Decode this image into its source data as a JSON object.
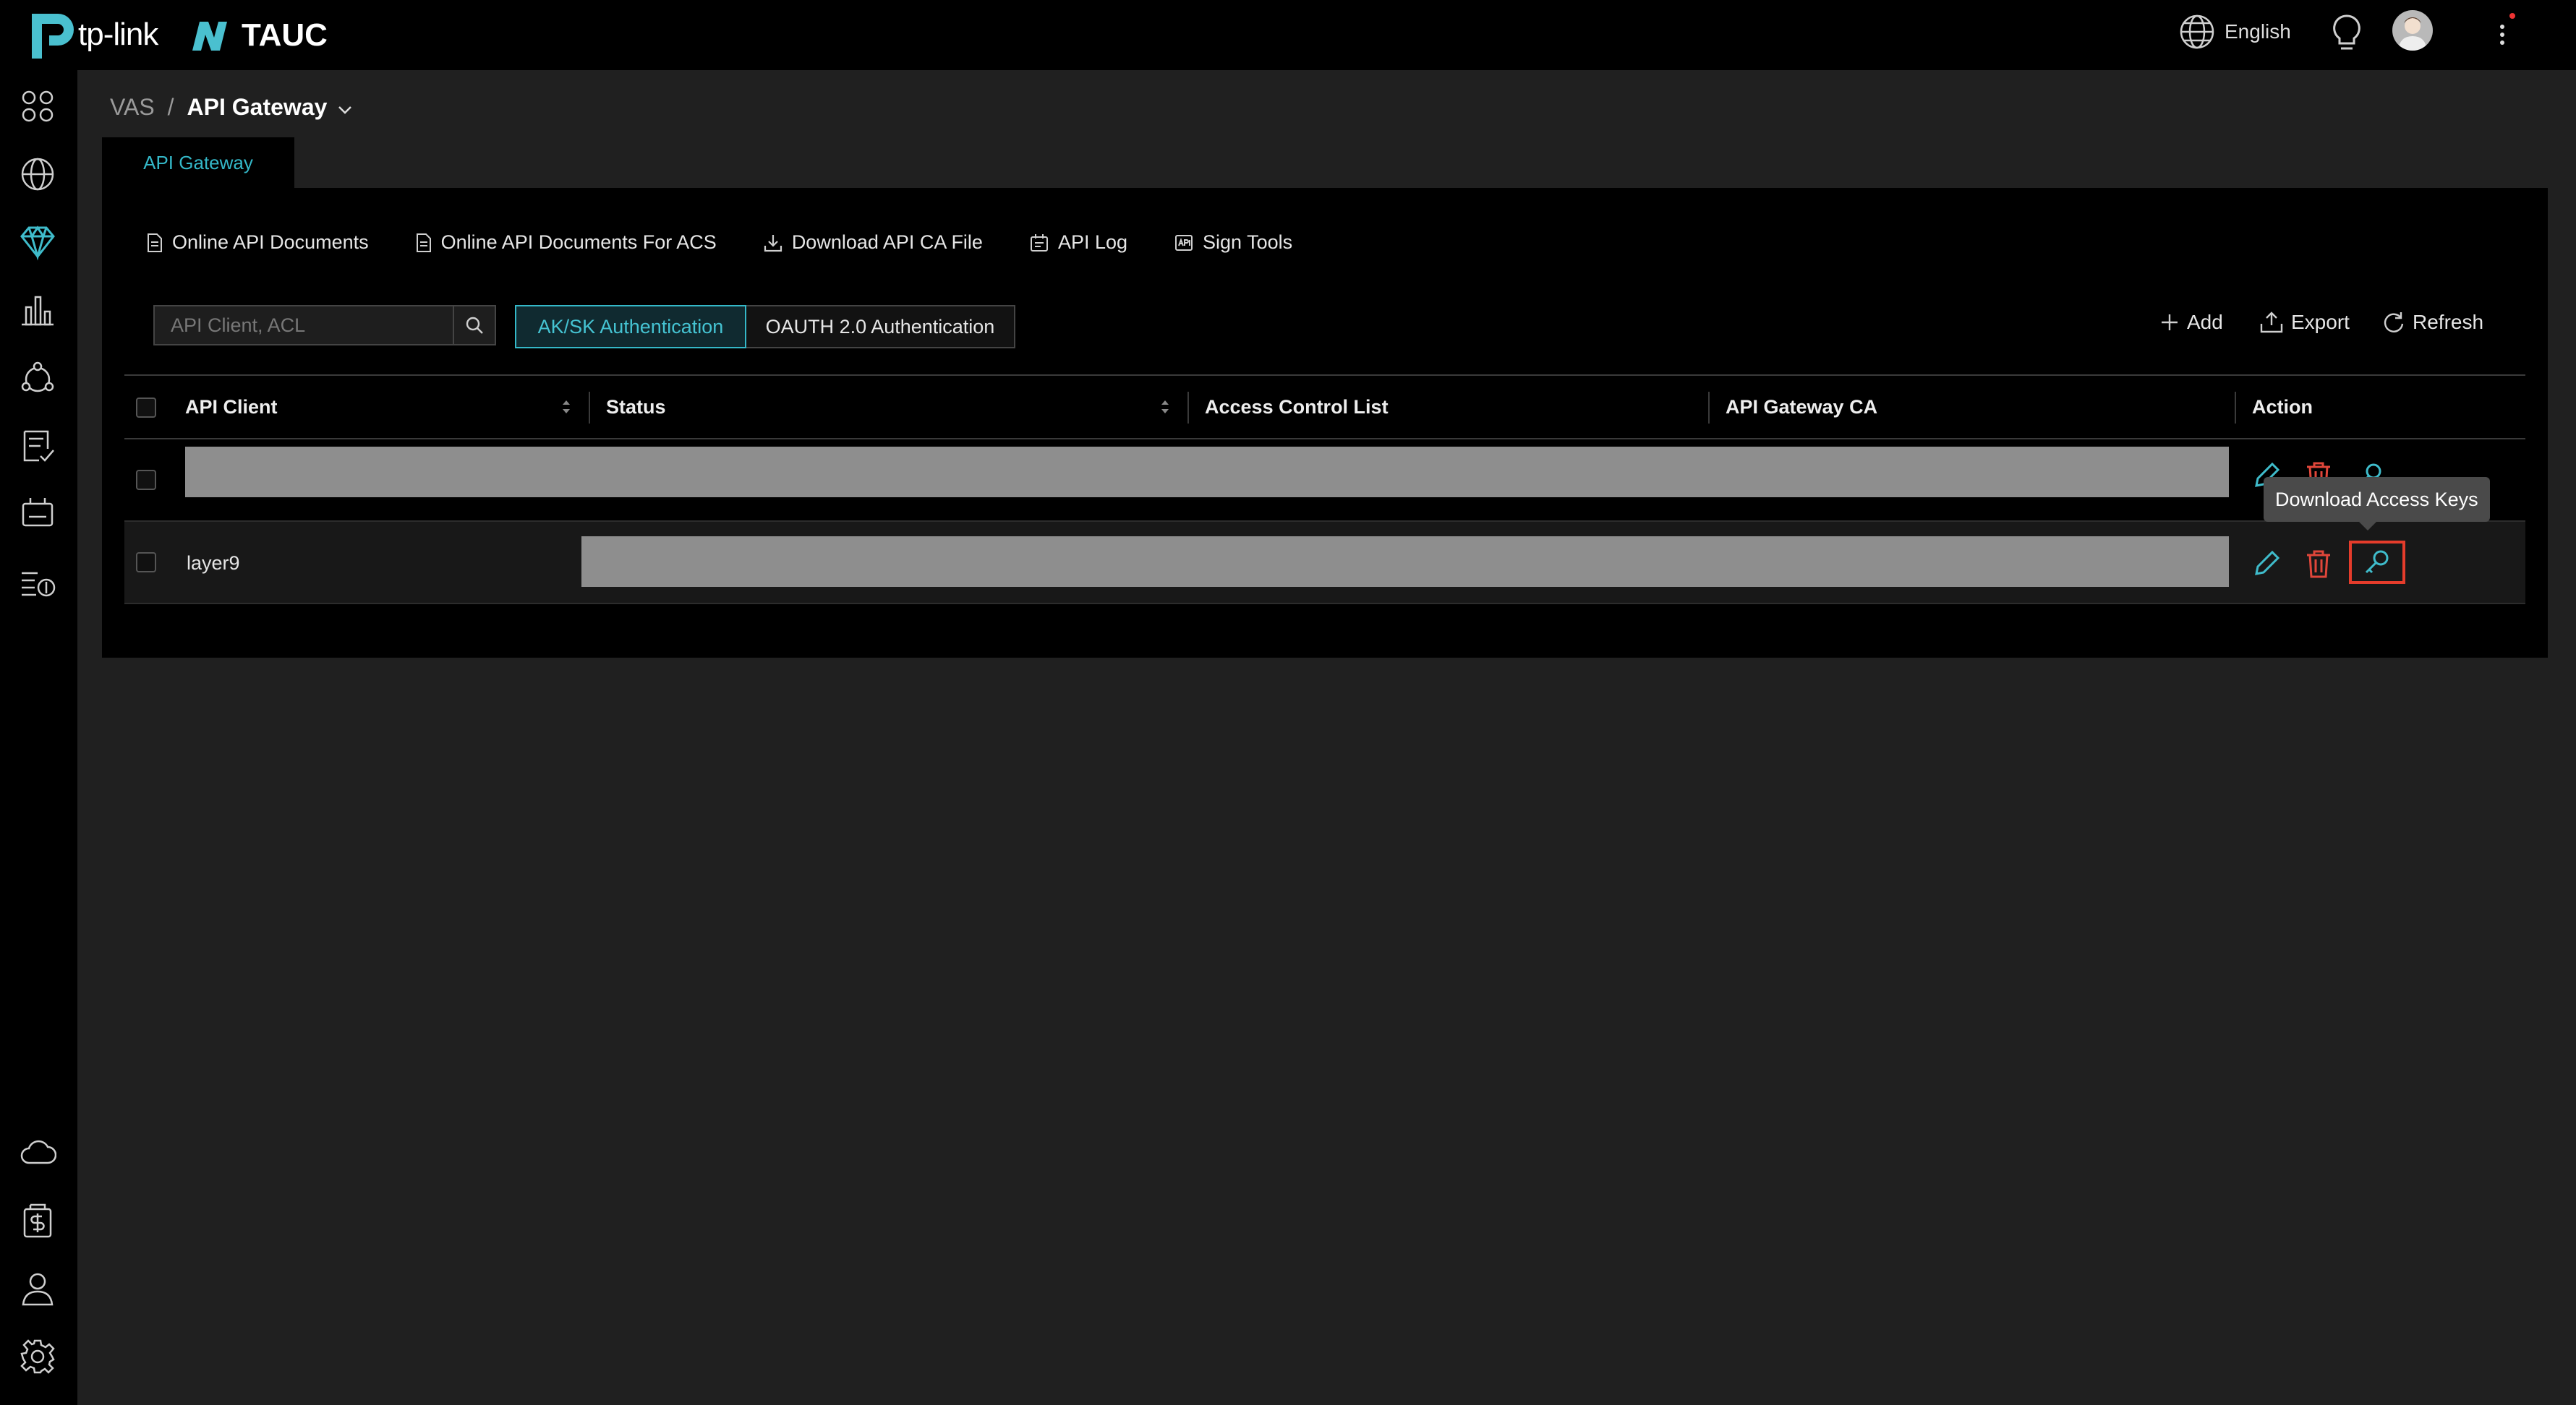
{
  "brand": {
    "tplink": "tp-link",
    "tauc": "TAUC"
  },
  "header": {
    "language": "English"
  },
  "breadcrumb": {
    "root": "VAS",
    "separator": "/",
    "current": "API Gateway"
  },
  "tabs": [
    {
      "label": "API Gateway",
      "active": true
    }
  ],
  "doc_links": [
    {
      "label": "Online API Documents",
      "icon": "document-icon"
    },
    {
      "label": "Online API Documents For ACS",
      "icon": "document-icon"
    },
    {
      "label": "Download API CA File",
      "icon": "download-icon"
    },
    {
      "label": "API Log",
      "icon": "log-icon"
    },
    {
      "label": "Sign Tools",
      "icon": "api-icon"
    }
  ],
  "search": {
    "placeholder": "API Client, ACL",
    "value": ""
  },
  "auth_toggle": {
    "ak_sk": "AK/SK Authentication",
    "oauth": "OAUTH 2.0 Authentication",
    "selected": "ak_sk"
  },
  "toolbar": {
    "add": "Add",
    "export": "Export",
    "refresh": "Refresh"
  },
  "table": {
    "columns": [
      "API Client",
      "Status",
      "Access Control List",
      "API Gateway CA",
      "Action"
    ],
    "rows": [
      {
        "api_client": "",
        "redacted": true
      },
      {
        "api_client": "layer9",
        "redacted": true
      }
    ]
  },
  "tooltip": {
    "text": "Download Access Keys"
  },
  "colors": {
    "accent": "#34b8c8",
    "danger": "#e0463a",
    "highlight": "#e53c2b"
  }
}
